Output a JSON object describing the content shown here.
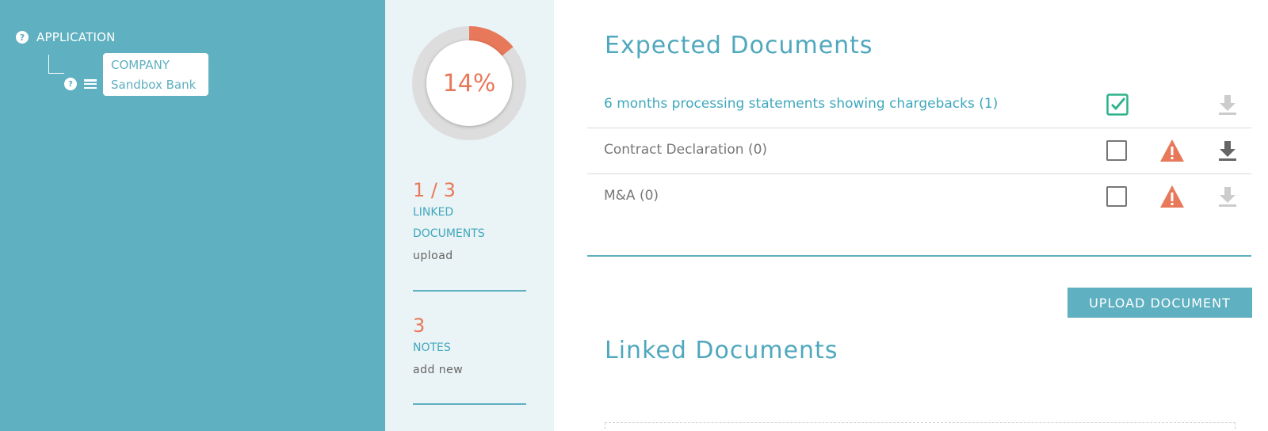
{
  "tree": {
    "root_label": "APPLICATION",
    "help_glyph": "?",
    "child": {
      "line1": "COMPANY",
      "line2": "Sandbox Bank"
    }
  },
  "stats": {
    "progress_text": "14%",
    "progress_fraction": 0.14,
    "linked": {
      "value": "1 / 3",
      "label_line1": "LINKED",
      "label_line2": "DOCUMENTS",
      "action": "upload"
    },
    "notes": {
      "value": "3",
      "label": "NOTES",
      "action": "add new"
    }
  },
  "main": {
    "expected_title": "Expected Documents",
    "documents": [
      {
        "name": "6 months processing statements showing chargebacks (1)",
        "checked": true,
        "warning": false,
        "download_enabled": false
      },
      {
        "name": "Contract Declaration (0)",
        "checked": false,
        "warning": true,
        "download_enabled": true
      },
      {
        "name": "M&A (0)",
        "checked": false,
        "warning": true,
        "download_enabled": false
      }
    ],
    "upload_label": "UPLOAD DOCUMENT",
    "linked_title": "Linked Documents"
  },
  "colors": {
    "panel_teal": "#5fb0c0",
    "accent_orange": "#e8785a",
    "check_green": "#2bb28a",
    "stats_bg": "#eaf3f5"
  }
}
